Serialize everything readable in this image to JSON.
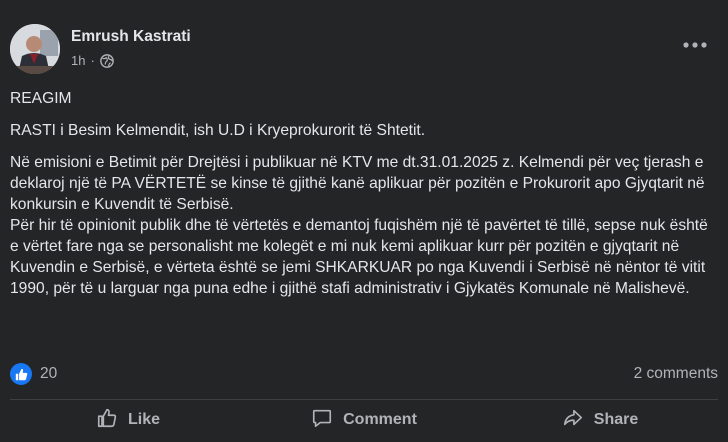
{
  "post": {
    "author": "Emrush Kastrati",
    "time": "1h",
    "separator": "·",
    "paragraphs": [
      "REAGIM",
      "RASTI i Besim Kelmendit, ish U.D i Kryeprokurorit të Shtetit.",
      "Në emisioni e Betimit për Drejtësi i publikuar në KTV me dt.31.01.2025 z. Kelmendi për veç tjerash e deklaroj një të PA VËRTETË se kinse të gjithë kanë aplikuar për pozitën e Prokurorit apo Gjyqtarit në konkursin e Kuvendit të Serbisë.",
      "Për hir të opinionit publik dhe të vërtetës e demantoj fuqishëm një të pavërtet të tillë, sepse nuk është e vërtet fare nga se personalisht me kolegët e mi nuk kemi aplikuar kurr për pozitën e gjyqtarit në Kuvendin e Serbisë, e vërteta është se jemi SHKARKUAR po nga Kuvendi i Serbisë në nëntor të vitit 1990, për të u larguar nga puna edhe i gjithë stafi administrativ i Gjykatës Komunale në Malishevë."
    ]
  },
  "stats": {
    "like_count": "20",
    "comments_label": "2 comments"
  },
  "actions": {
    "like": "Like",
    "comment": "Comment",
    "share": "Share"
  },
  "icons": {
    "more": "more-options-icon",
    "globe": "globe-icon",
    "like_badge": "like-badge-icon",
    "like": "thumbs-up-icon",
    "comment": "comment-icon",
    "share": "share-icon"
  },
  "colors": {
    "background": "#242526",
    "text": "#e4e6eb",
    "secondary": "#b0b3b8",
    "accent": "#1877f2"
  }
}
